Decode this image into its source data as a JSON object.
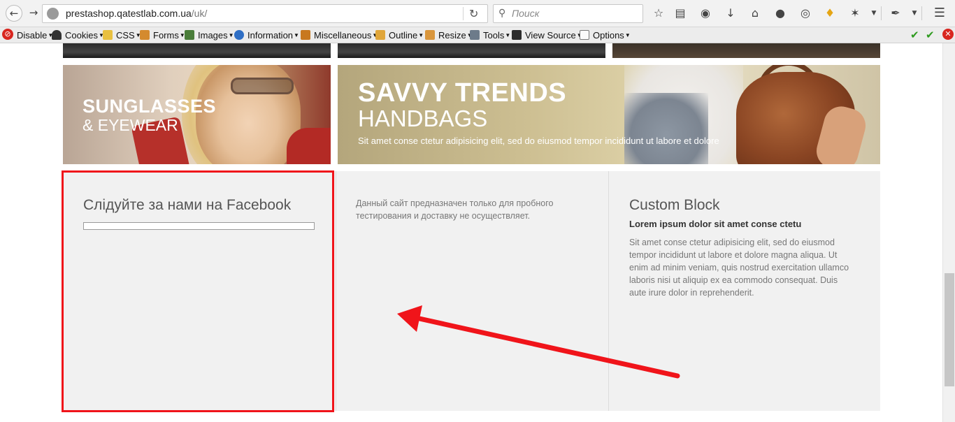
{
  "browser": {
    "url_host": "prestashop.qatestlab.com.ua",
    "url_path": "/uk/",
    "search_placeholder": "Поиск"
  },
  "devtoolbar": {
    "items": [
      {
        "label": "Disable",
        "icon": "stop-icon"
      },
      {
        "label": "Cookies",
        "icon": "person-icon"
      },
      {
        "label": "CSS",
        "icon": "pencil-icon"
      },
      {
        "label": "Forms",
        "icon": "clipboard-icon"
      },
      {
        "label": "Images",
        "icon": "image-icon"
      },
      {
        "label": "Information",
        "icon": "info-icon"
      },
      {
        "label": "Miscellaneous",
        "icon": "book-icon"
      },
      {
        "label": "Outline",
        "icon": "pencil-icon"
      },
      {
        "label": "Resize",
        "icon": "pencil-icon"
      },
      {
        "label": "Tools",
        "icon": "tools-icon"
      },
      {
        "label": "View Source",
        "icon": "terminal-icon"
      },
      {
        "label": "Options",
        "icon": "document-icon"
      }
    ]
  },
  "banners": {
    "sunglasses": {
      "line1": "SUNGLASSES",
      "line2": "& EYEWEAR"
    },
    "handbags": {
      "line1": "SAVVY TRENDS",
      "line2": "HANDBAGS",
      "line3": "Sit amet conse ctetur adipisicing elit, sed do eiusmod tempor incididunt ut labore et dolore"
    }
  },
  "footer": {
    "facebook_title": "Слідуйте за нами на Facebook",
    "note": "Данный сайт предназначен только для пробного тестирования и доставку не осуществляет.",
    "custom_block": {
      "title": "Custom Block",
      "subtitle": "Lorem ipsum dolor sit amet conse ctetu",
      "text": "Sit amet conse ctetur adipisicing elit, sed do eiusmod tempor incididunt ut labore et dolore magna aliqua. Ut enim ad minim veniam, quis nostrud exercitation ullamco laboris nisi ut aliquip ex ea commodo consequat. Duis aute irure dolor in reprehenderit."
    }
  },
  "annotation_color": "#f0141a"
}
